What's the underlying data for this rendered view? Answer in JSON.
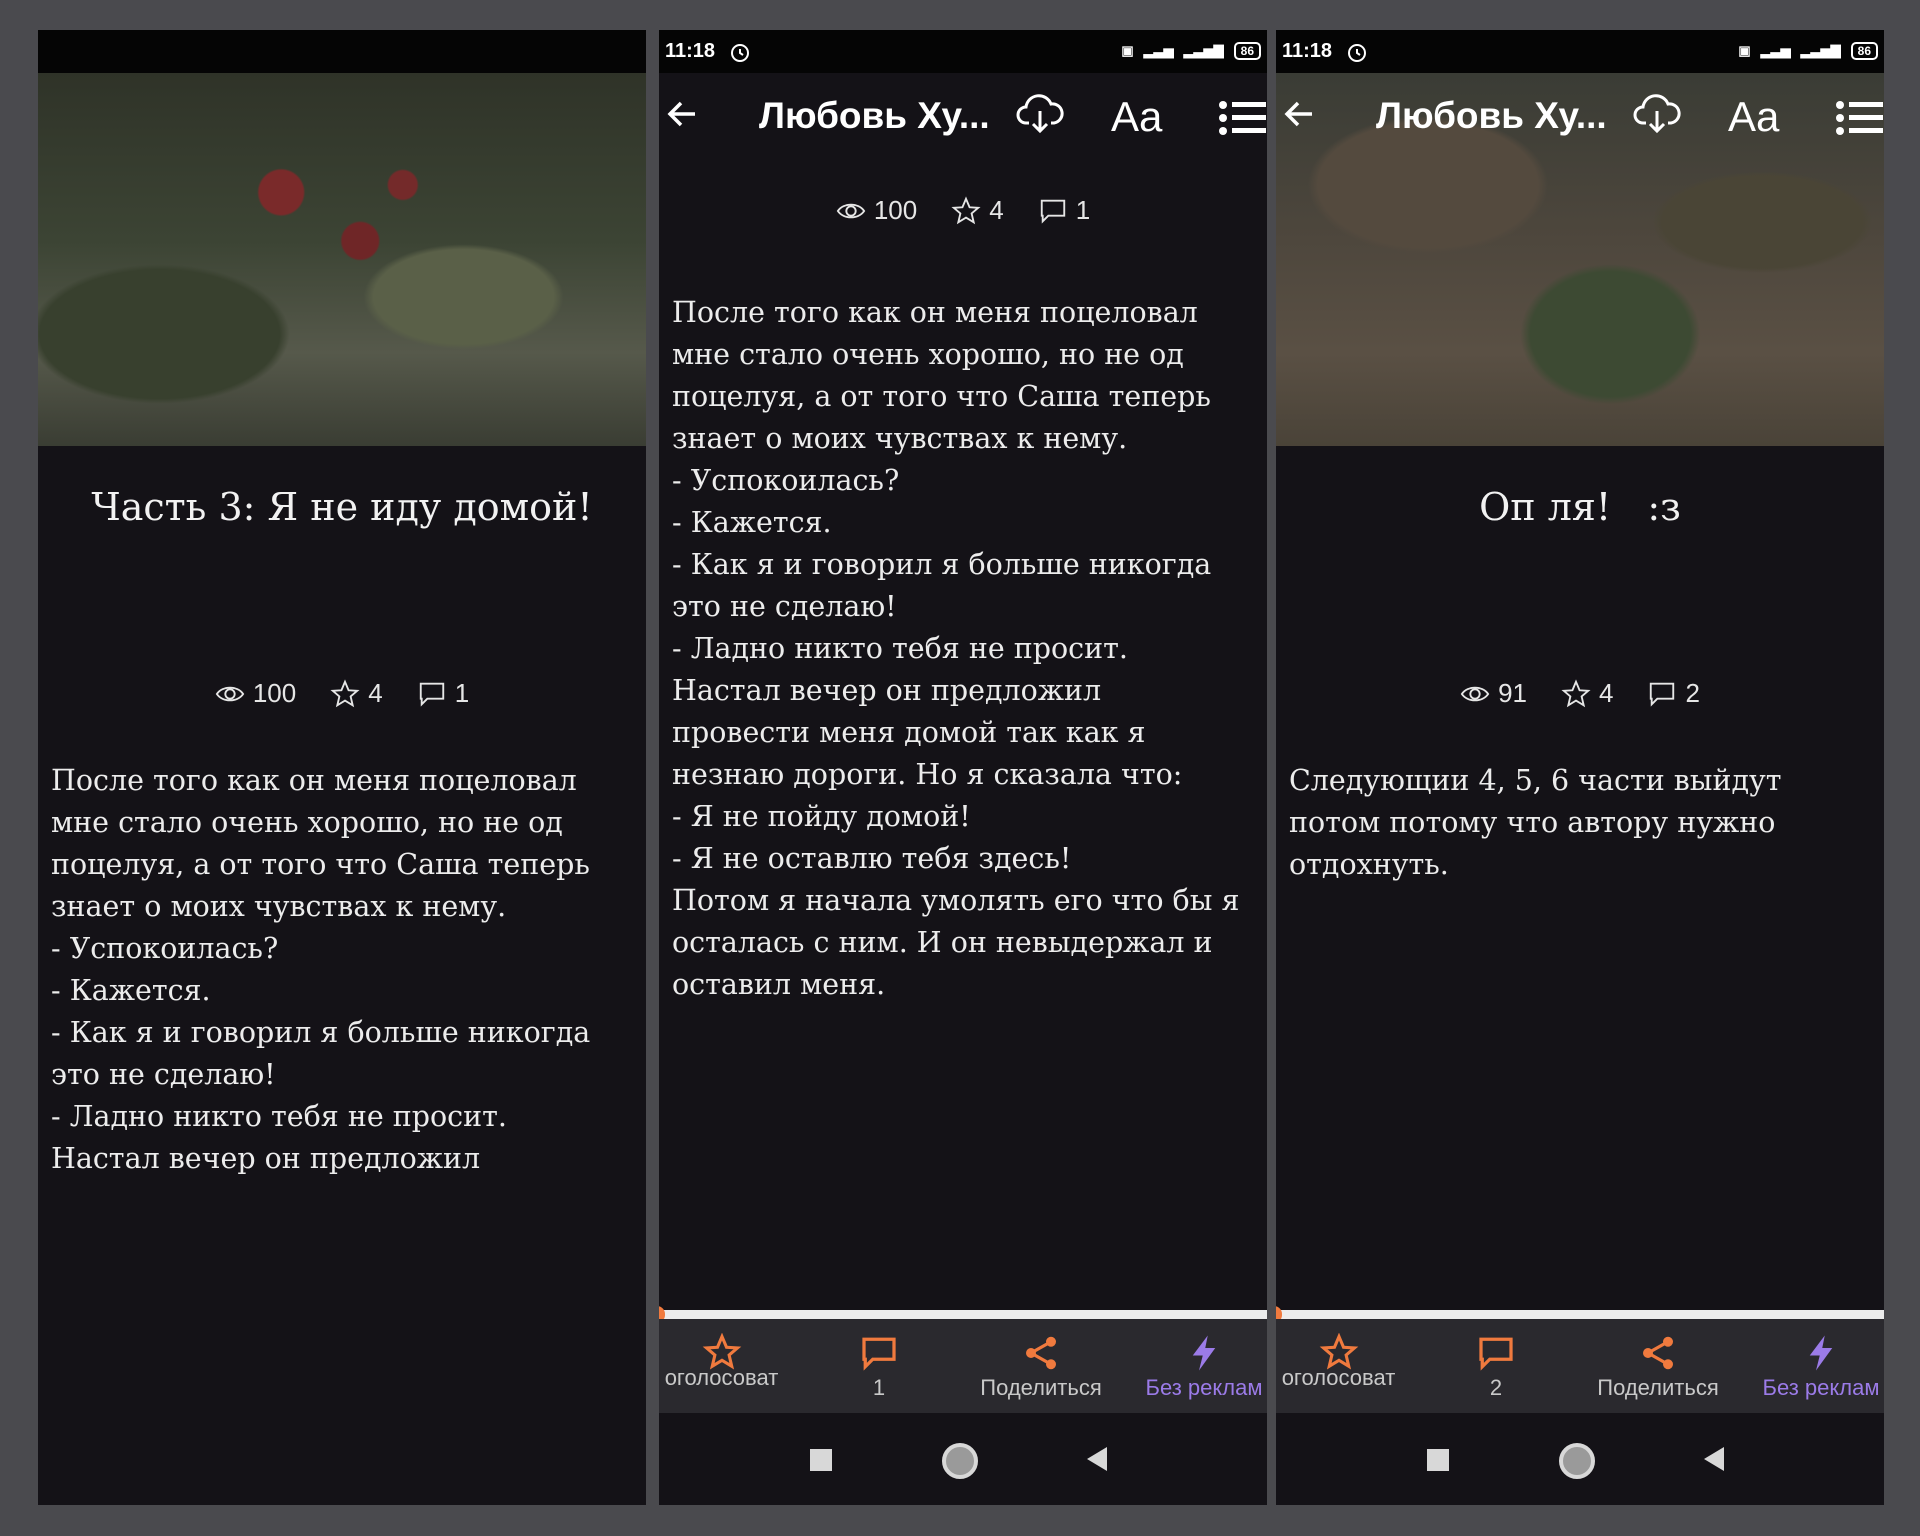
{
  "panel1": {
    "title": "Часть 3: Я не иду домой!",
    "stats": {
      "views": "100",
      "votes": "4",
      "comments": "1"
    },
    "text": "После того как он меня поцеловал\nмне стало очень хорошо, но не од\nпоцелуя, а от того что Саша теперь\nзнает о моих чувствах к нему.\n- Успокоилась?\n- Кажется.\n- Как я и говорил я больше никогда\nэто не сделаю!\n- Ладно никто тебя не просит.\nНастал вечер он предложил"
  },
  "panel2": {
    "status": {
      "time": "11:18",
      "battery": "86"
    },
    "appbar": {
      "title": "Любовь Ху...",
      "font_button": "Aa"
    },
    "stats": {
      "views": "100",
      "votes": "4",
      "comments": "1"
    },
    "text": "После того как он меня поцеловал\nмне стало очень хорошо, но не од\nпоцелуя, а от того что Саша теперь\nзнает о моих чувствах к нему.\n- Успокоилась?\n- Кажется.\n- Как я и говорил я больше никогда\nэто не сделаю!\n- Ладно никто тебя не просит.\nНастал вечер он предложил\nпровести меня домой так как я\nнезнаю дороги. Но я сказала что:\n- Я не пойду домой!\n- Я не оставлю тебя здесь!\nПотом я начала умолять его что бы я\nосталась с ним. И он невыдержал и\nоставил меня.",
    "bottom": {
      "vote": "оголосоват",
      "comments": "1",
      "share": "Поделиться",
      "noads": "Без реклам"
    }
  },
  "panel3": {
    "status": {
      "time": "11:18",
      "battery": "86"
    },
    "appbar": {
      "title": "Любовь Ху...",
      "font_button": "Aa"
    },
    "title": "Оп ля!   :з",
    "stats": {
      "views": "91",
      "votes": "4",
      "comments": "2"
    },
    "text": "Следующии 4, 5, 6 части выйдут\nпотом потому что автору нужно\nотдохнуть.",
    "bottom": {
      "vote": "оголосоват",
      "comments": "2",
      "share": "Поделиться",
      "noads": "Без реклам"
    }
  },
  "colors": {
    "accent": "#f07a3e",
    "purple": "#9b7be8",
    "bg": "#141217",
    "frame": "#4a4a4e"
  },
  "icons": [
    "eye-icon",
    "star-icon",
    "comment-icon",
    "back-arrow-icon",
    "download-cloud-icon",
    "menu-list-icon",
    "share-icon",
    "lightning-icon",
    "alarm-icon"
  ]
}
